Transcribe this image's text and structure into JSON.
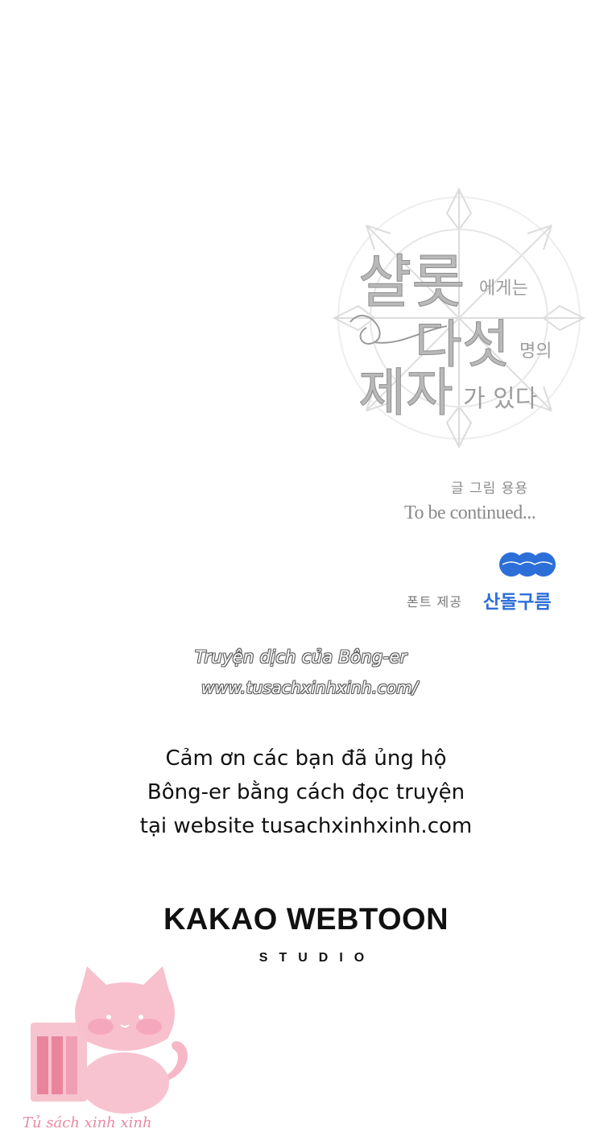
{
  "title_logo": {
    "line1_main": "샬롯",
    "line1_small": "에게는",
    "line2_main": "다섯",
    "line2_small": "명의",
    "line3_main": "제자",
    "line3_small": "가 있다"
  },
  "credit": "글 그림 용용",
  "ending": "To be continued...",
  "font_credit": {
    "label": "폰트 제공",
    "name": "산돌구름",
    "logo_color": "#2d6fd9"
  },
  "translator": {
    "line1": "Truyện dịch của Bông-er",
    "line2": "www.tusachxinhxinh.com/"
  },
  "thanks": {
    "line1": "Cảm ơn các bạn đã ủng hộ",
    "line2": "Bông-er bằng cách đọc truyện",
    "line3": "tại website tusachxinhxinh.com"
  },
  "studio": {
    "name": "KAKAO WEBTOON",
    "sub": "STUDIO"
  },
  "watermark": {
    "text": "Tủ sách xinh xinh",
    "icon": "pink-cat-mascot-icon",
    "color": "#e98aa2"
  }
}
